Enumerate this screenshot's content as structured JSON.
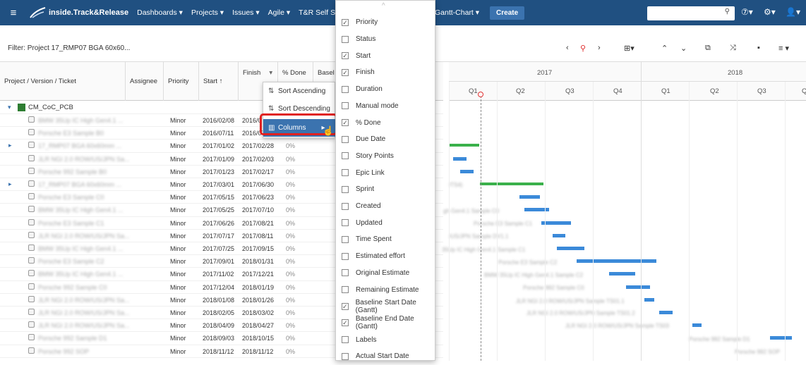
{
  "topbar": {
    "logo": "inside.Track&Release",
    "nav": [
      "Dashboards ▾",
      "Projects ▾",
      "Issues ▾",
      "Agile ▾",
      "T&R Self Service"
    ],
    "gantt": "Gantt-Chart ▾",
    "create": "Create",
    "search_icon": "search-icon",
    "help": "⑦▾",
    "gear": "⚙▾",
    "user": "👤▾"
  },
  "filter": "Filter:  Project 17_RMP07 BGA 60x60...",
  "columns": {
    "project": "Project / Version / Ticket",
    "assignee": "Assignee",
    "priority": "Priority",
    "start": "Start ↑",
    "finish": "Finish",
    "done": "% Done",
    "baseline": "Basel"
  },
  "group": "CM_CoC_PCB",
  "rows": [
    {
      "name": "BMW 35Up IC High Gen4.1 ...",
      "priority": "Minor",
      "start": "2016/02/08",
      "finish": "2016/0",
      "done": ""
    },
    {
      "name": "Porsche E3 Sample B0",
      "priority": "Minor",
      "start": "2016/07/11",
      "finish": "2016/07",
      "done": ""
    },
    {
      "name": "17_RMP07 BGA 60x60mm ...",
      "priority": "Minor",
      "start": "2017/01/02",
      "finish": "2017/02/28",
      "done": "0%"
    },
    {
      "name": "JLR NGI 2.0 ROW/US/JPN Sa...",
      "priority": "Minor",
      "start": "2017/01/09",
      "finish": "2017/02/03",
      "done": "0%"
    },
    {
      "name": "Porsche 992 Sample B0",
      "priority": "Minor",
      "start": "2017/01/23",
      "finish": "2017/02/17",
      "done": "0%"
    },
    {
      "name": "17_RMP07 BGA 60x60mm ...",
      "priority": "Minor",
      "start": "2017/03/01",
      "finish": "2017/06/30",
      "done": "0%"
    },
    {
      "name": "Porsche E3 Sample C0",
      "priority": "Minor",
      "start": "2017/05/15",
      "finish": "2017/06/23",
      "done": "0%"
    },
    {
      "name": "BMW 35Up IC High Gen4.1 ...",
      "priority": "Minor",
      "start": "2017/05/25",
      "finish": "2017/07/10",
      "done": "0%"
    },
    {
      "name": "Porsche E3 Sample C1",
      "priority": "Minor",
      "start": "2017/06/26",
      "finish": "2017/08/21",
      "done": "0%"
    },
    {
      "name": "JLR NGI 2.0 ROW/US/JPN Sa...",
      "priority": "Minor",
      "start": "2017/07/17",
      "finish": "2017/08/11",
      "done": "0%"
    },
    {
      "name": "BMW 35Up IC High Gen4.1 ...",
      "priority": "Minor",
      "start": "2017/07/25",
      "finish": "2017/09/15",
      "done": "0%"
    },
    {
      "name": "Porsche E3 Sample C2",
      "priority": "Minor",
      "start": "2017/09/01",
      "finish": "2018/01/31",
      "done": "0%"
    },
    {
      "name": "BMW 35Up IC High Gen4.1 ...",
      "priority": "Minor",
      "start": "2017/11/02",
      "finish": "2017/12/21",
      "done": "0%"
    },
    {
      "name": "Porsche 992 Sample C0",
      "priority": "Minor",
      "start": "2017/12/04",
      "finish": "2018/01/19",
      "done": "0%"
    },
    {
      "name": "JLR NGI 2.0 ROW/US/JPN Sa...",
      "priority": "Minor",
      "start": "2018/01/08",
      "finish": "2018/01/26",
      "done": "0%"
    },
    {
      "name": "JLR NGI 2.0 ROW/US/JPN Sa...",
      "priority": "Minor",
      "start": "2018/02/05",
      "finish": "2018/03/02",
      "done": "0%"
    },
    {
      "name": "JLR NGI 2.0 ROW/US/JPN Sa...",
      "priority": "Minor",
      "start": "2018/04/09",
      "finish": "2018/04/27",
      "done": "0%"
    },
    {
      "name": "Porsche 992 Sample D1",
      "priority": "Minor",
      "start": "2018/09/03",
      "finish": "2018/10/15",
      "done": "0%"
    },
    {
      "name": "Porsche 992 SOP",
      "priority": "Minor",
      "start": "2018/11/12",
      "finish": "2018/11/12",
      "done": "0%"
    }
  ],
  "sortmenu": {
    "asc": "Sort Ascending",
    "desc": "Sort Descending",
    "columns": "Columns"
  },
  "colmenu": [
    {
      "label": "Priority",
      "checked": true
    },
    {
      "label": "Status",
      "checked": false
    },
    {
      "label": "Start",
      "checked": true
    },
    {
      "label": "Finish",
      "checked": true
    },
    {
      "label": "Duration",
      "checked": false
    },
    {
      "label": "Manual mode",
      "checked": false
    },
    {
      "label": "% Done",
      "checked": true
    },
    {
      "label": "Due Date",
      "checked": false
    },
    {
      "label": "Story Points",
      "checked": false
    },
    {
      "label": "Epic Link",
      "checked": false
    },
    {
      "label": "Sprint",
      "checked": false
    },
    {
      "label": "Created",
      "checked": false
    },
    {
      "label": "Updated",
      "checked": false
    },
    {
      "label": "Time Spent",
      "checked": false
    },
    {
      "label": "Estimated effort",
      "checked": false
    },
    {
      "label": "Original Estimate",
      "checked": false
    },
    {
      "label": "Remaining Estimate",
      "checked": false
    },
    {
      "label": "Baseline Start Date (Gantt)",
      "checked": true
    },
    {
      "label": "Baseline End Date (Gantt)",
      "checked": true
    },
    {
      "label": "Labels",
      "checked": false
    },
    {
      "label": "Actual Start Date",
      "checked": false
    }
  ],
  "gantt": {
    "years": [
      "2017",
      "2018"
    ],
    "quarters": [
      "Q1",
      "Q2",
      "Q3",
      "Q4",
      "Q1",
      "Q2",
      "Q3",
      "Q"
    ],
    "labels": [
      "ITS4)",
      "gh Gen4.1 Sample C0",
      "Porsche E3 Sample C1",
      "/US/JPN Sample DV1.1",
      "35Up IC High Gen4.1 Sample C1",
      "Porsche E3 Sample C2",
      "BMW 35Up IC High Gen4.1 Sample C2",
      "Porsche 992 Sample C0",
      "JLR NGI 2.0 ROW/US/JPN Sample TS01.1",
      "JLR NGI 2.0 ROW/US/JPN Sample TS01.2",
      "JLR NGI 2.0 ROW/US/JPN Sample TS03",
      "Porsche 992 Sample D1",
      "Porsche 992 SOP"
    ],
    "colors": {
      "bar": "#3b8ad9",
      "summary": "#3ab14b",
      "today": "#e03030"
    }
  }
}
